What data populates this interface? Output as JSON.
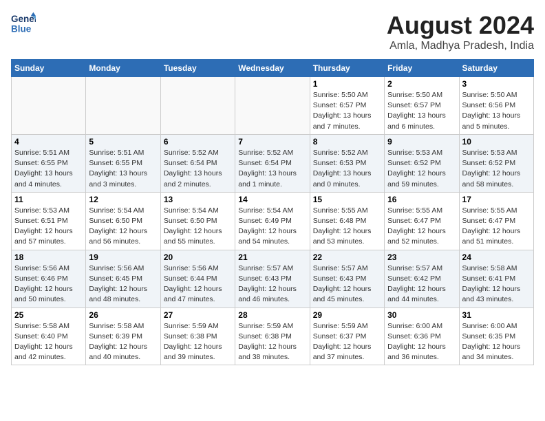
{
  "header": {
    "logo_line1": "General",
    "logo_line2": "Blue",
    "month_year": "August 2024",
    "location": "Amla, Madhya Pradesh, India"
  },
  "days_of_week": [
    "Sunday",
    "Monday",
    "Tuesday",
    "Wednesday",
    "Thursday",
    "Friday",
    "Saturday"
  ],
  "weeks": [
    [
      {
        "day": "",
        "info": ""
      },
      {
        "day": "",
        "info": ""
      },
      {
        "day": "",
        "info": ""
      },
      {
        "day": "",
        "info": ""
      },
      {
        "day": "1",
        "info": "Sunrise: 5:50 AM\nSunset: 6:57 PM\nDaylight: 13 hours\nand 7 minutes."
      },
      {
        "day": "2",
        "info": "Sunrise: 5:50 AM\nSunset: 6:57 PM\nDaylight: 13 hours\nand 6 minutes."
      },
      {
        "day": "3",
        "info": "Sunrise: 5:50 AM\nSunset: 6:56 PM\nDaylight: 13 hours\nand 5 minutes."
      }
    ],
    [
      {
        "day": "4",
        "info": "Sunrise: 5:51 AM\nSunset: 6:55 PM\nDaylight: 13 hours\nand 4 minutes."
      },
      {
        "day": "5",
        "info": "Sunrise: 5:51 AM\nSunset: 6:55 PM\nDaylight: 13 hours\nand 3 minutes."
      },
      {
        "day": "6",
        "info": "Sunrise: 5:52 AM\nSunset: 6:54 PM\nDaylight: 13 hours\nand 2 minutes."
      },
      {
        "day": "7",
        "info": "Sunrise: 5:52 AM\nSunset: 6:54 PM\nDaylight: 13 hours\nand 1 minute."
      },
      {
        "day": "8",
        "info": "Sunrise: 5:52 AM\nSunset: 6:53 PM\nDaylight: 13 hours\nand 0 minutes."
      },
      {
        "day": "9",
        "info": "Sunrise: 5:53 AM\nSunset: 6:52 PM\nDaylight: 12 hours\nand 59 minutes."
      },
      {
        "day": "10",
        "info": "Sunrise: 5:53 AM\nSunset: 6:52 PM\nDaylight: 12 hours\nand 58 minutes."
      }
    ],
    [
      {
        "day": "11",
        "info": "Sunrise: 5:53 AM\nSunset: 6:51 PM\nDaylight: 12 hours\nand 57 minutes."
      },
      {
        "day": "12",
        "info": "Sunrise: 5:54 AM\nSunset: 6:50 PM\nDaylight: 12 hours\nand 56 minutes."
      },
      {
        "day": "13",
        "info": "Sunrise: 5:54 AM\nSunset: 6:50 PM\nDaylight: 12 hours\nand 55 minutes."
      },
      {
        "day": "14",
        "info": "Sunrise: 5:54 AM\nSunset: 6:49 PM\nDaylight: 12 hours\nand 54 minutes."
      },
      {
        "day": "15",
        "info": "Sunrise: 5:55 AM\nSunset: 6:48 PM\nDaylight: 12 hours\nand 53 minutes."
      },
      {
        "day": "16",
        "info": "Sunrise: 5:55 AM\nSunset: 6:47 PM\nDaylight: 12 hours\nand 52 minutes."
      },
      {
        "day": "17",
        "info": "Sunrise: 5:55 AM\nSunset: 6:47 PM\nDaylight: 12 hours\nand 51 minutes."
      }
    ],
    [
      {
        "day": "18",
        "info": "Sunrise: 5:56 AM\nSunset: 6:46 PM\nDaylight: 12 hours\nand 50 minutes."
      },
      {
        "day": "19",
        "info": "Sunrise: 5:56 AM\nSunset: 6:45 PM\nDaylight: 12 hours\nand 48 minutes."
      },
      {
        "day": "20",
        "info": "Sunrise: 5:56 AM\nSunset: 6:44 PM\nDaylight: 12 hours\nand 47 minutes."
      },
      {
        "day": "21",
        "info": "Sunrise: 5:57 AM\nSunset: 6:43 PM\nDaylight: 12 hours\nand 46 minutes."
      },
      {
        "day": "22",
        "info": "Sunrise: 5:57 AM\nSunset: 6:43 PM\nDaylight: 12 hours\nand 45 minutes."
      },
      {
        "day": "23",
        "info": "Sunrise: 5:57 AM\nSunset: 6:42 PM\nDaylight: 12 hours\nand 44 minutes."
      },
      {
        "day": "24",
        "info": "Sunrise: 5:58 AM\nSunset: 6:41 PM\nDaylight: 12 hours\nand 43 minutes."
      }
    ],
    [
      {
        "day": "25",
        "info": "Sunrise: 5:58 AM\nSunset: 6:40 PM\nDaylight: 12 hours\nand 42 minutes."
      },
      {
        "day": "26",
        "info": "Sunrise: 5:58 AM\nSunset: 6:39 PM\nDaylight: 12 hours\nand 40 minutes."
      },
      {
        "day": "27",
        "info": "Sunrise: 5:59 AM\nSunset: 6:38 PM\nDaylight: 12 hours\nand 39 minutes."
      },
      {
        "day": "28",
        "info": "Sunrise: 5:59 AM\nSunset: 6:38 PM\nDaylight: 12 hours\nand 38 minutes."
      },
      {
        "day": "29",
        "info": "Sunrise: 5:59 AM\nSunset: 6:37 PM\nDaylight: 12 hours\nand 37 minutes."
      },
      {
        "day": "30",
        "info": "Sunrise: 6:00 AM\nSunset: 6:36 PM\nDaylight: 12 hours\nand 36 minutes."
      },
      {
        "day": "31",
        "info": "Sunrise: 6:00 AM\nSunset: 6:35 PM\nDaylight: 12 hours\nand 34 minutes."
      }
    ]
  ]
}
